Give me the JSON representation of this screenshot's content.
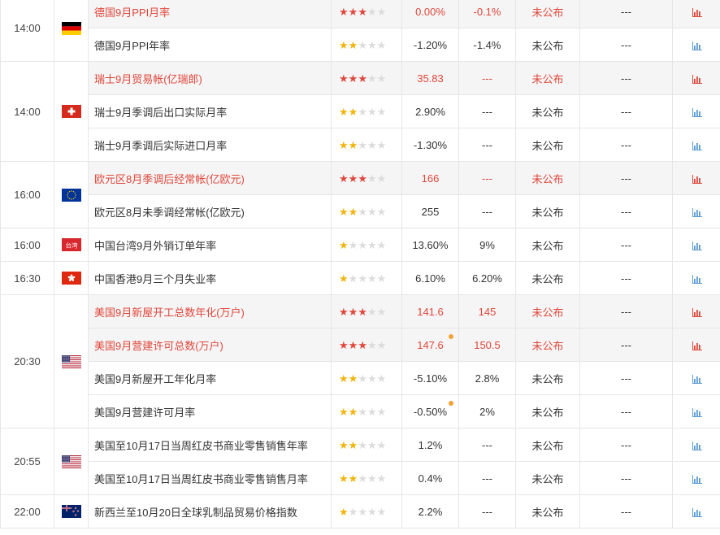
{
  "colors": {
    "important_text": "#e0473c",
    "star_high": "#e0473c",
    "star_low": "#f2b40d",
    "chart_icon_high": "#e0473c",
    "chart_icon_low": "#5b9bd5"
  },
  "groups": [
    {
      "time": "14:00",
      "flag": "germany-flag",
      "events": [
        {
          "name": "德国9月PPI月率",
          "stars": 3,
          "previous": "0.00%",
          "forecast": "-0.1%",
          "actual": "未公布",
          "extra": "---",
          "important": true,
          "dot": false
        },
        {
          "name": "德国9月PPI年率",
          "stars": 2,
          "previous": "-1.20%",
          "forecast": "-1.4%",
          "actual": "未公布",
          "extra": "---",
          "important": false,
          "dot": false
        }
      ]
    },
    {
      "time": "14:00",
      "flag": "switzerland-flag",
      "events": [
        {
          "name": "瑞士9月贸易帐(亿瑞郎)",
          "stars": 3,
          "previous": "35.83",
          "forecast": "---",
          "actual": "未公布",
          "extra": "---",
          "important": true,
          "dot": false
        },
        {
          "name": "瑞士9月季调后出口实际月率",
          "stars": 2,
          "previous": "2.90%",
          "forecast": "---",
          "actual": "未公布",
          "extra": "---",
          "important": false,
          "dot": false
        },
        {
          "name": "瑞士9月季调后实际进口月率",
          "stars": 2,
          "previous": "-1.30%",
          "forecast": "---",
          "actual": "未公布",
          "extra": "---",
          "important": false,
          "dot": false
        }
      ]
    },
    {
      "time": "16:00",
      "flag": "eu-flag",
      "events": [
        {
          "name": "欧元区8月季调后经常帐(亿欧元)",
          "stars": 3,
          "previous": "166",
          "forecast": "---",
          "actual": "未公布",
          "extra": "---",
          "important": true,
          "dot": false
        },
        {
          "name": "欧元区8月未季调经常帐(亿欧元)",
          "stars": 2,
          "previous": "255",
          "forecast": "---",
          "actual": "未公布",
          "extra": "---",
          "important": false,
          "dot": false
        }
      ]
    },
    {
      "time": "16:00",
      "flag": "taiwan-flag",
      "flag_text": "台湾",
      "events": [
        {
          "name": "中国台湾9月外销订单年率",
          "stars": 1,
          "previous": "13.60%",
          "forecast": "9%",
          "actual": "未公布",
          "extra": "---",
          "important": false,
          "dot": false
        }
      ]
    },
    {
      "time": "16:30",
      "flag": "hongkong-flag",
      "events": [
        {
          "name": "中国香港9月三个月失业率",
          "stars": 1,
          "previous": "6.10%",
          "forecast": "6.20%",
          "actual": "未公布",
          "extra": "---",
          "important": false,
          "dot": false
        }
      ]
    },
    {
      "time": "20:30",
      "flag": "usa-flag",
      "events": [
        {
          "name": "美国9月新屋开工总数年化(万户)",
          "stars": 3,
          "previous": "141.6",
          "forecast": "145",
          "actual": "未公布",
          "extra": "---",
          "important": true,
          "dot": false
        },
        {
          "name": "美国9月营建许可总数(万户)",
          "stars": 3,
          "previous": "147.6",
          "forecast": "150.5",
          "actual": "未公布",
          "extra": "---",
          "important": true,
          "dot": true
        },
        {
          "name": "美国9月新屋开工年化月率",
          "stars": 2,
          "previous": "-5.10%",
          "forecast": "2.8%",
          "actual": "未公布",
          "extra": "---",
          "important": false,
          "dot": false
        },
        {
          "name": "美国9月营建许可月率",
          "stars": 2,
          "previous": "-0.50%",
          "forecast": "2%",
          "actual": "未公布",
          "extra": "---",
          "important": false,
          "dot": true
        }
      ]
    },
    {
      "time": "20:55",
      "flag": "usa-flag",
      "events": [
        {
          "name": "美国至10月17日当周红皮书商业零售销售年率",
          "stars": 2,
          "previous": "1.2%",
          "forecast": "---",
          "actual": "未公布",
          "extra": "---",
          "important": false,
          "dot": false
        },
        {
          "name": "美国至10月17日当周红皮书商业零售销售月率",
          "stars": 2,
          "previous": "0.4%",
          "forecast": "---",
          "actual": "未公布",
          "extra": "---",
          "important": false,
          "dot": false
        }
      ]
    },
    {
      "time": "22:00",
      "flag": "newzealand-flag",
      "events": [
        {
          "name": "新西兰至10月20日全球乳制品贸易价格指数",
          "stars": 1,
          "previous": "2.2%",
          "forecast": "---",
          "actual": "未公布",
          "extra": "---",
          "important": false,
          "dot": false
        }
      ]
    }
  ]
}
